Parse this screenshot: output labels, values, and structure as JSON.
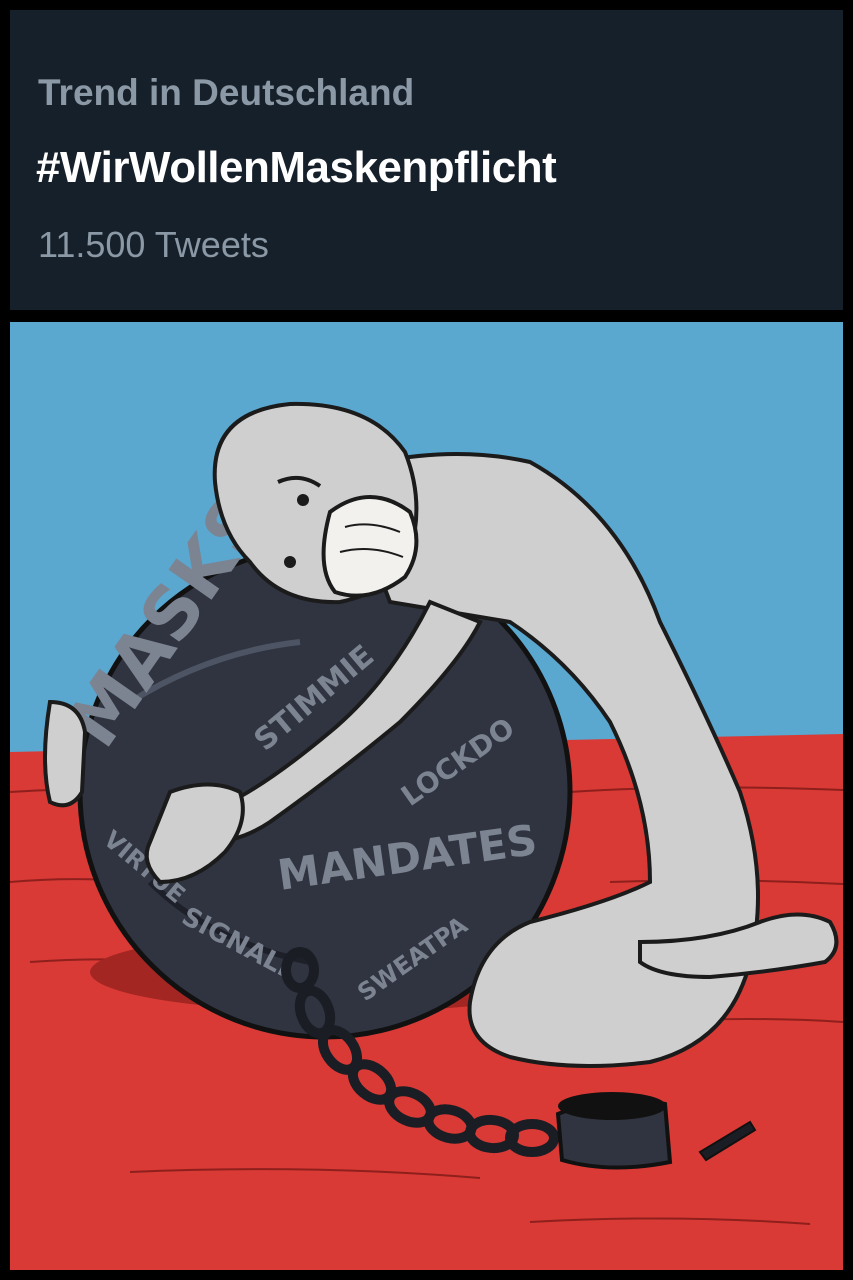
{
  "trend": {
    "context": "Trend in Deutschland",
    "hashtag": "#WirWollenMaskenpflicht",
    "count": "11.500 Tweets"
  },
  "cartoon": {
    "ball_words": {
      "w1": "MASKS",
      "w2": "STIMMIE",
      "w3": "LOCKDO",
      "w4": "MANDATES",
      "w5": "VIRTUE",
      "w6": "SIGNALI",
      "w7": "SWEATPA"
    }
  },
  "colors": {
    "card_background": "#16202a",
    "card_secondary_text": "#8b98a5",
    "sky": "#5aa7cf",
    "floor": "#d93a35",
    "ball": "#2f3440",
    "figure": "#cfcfcf"
  }
}
